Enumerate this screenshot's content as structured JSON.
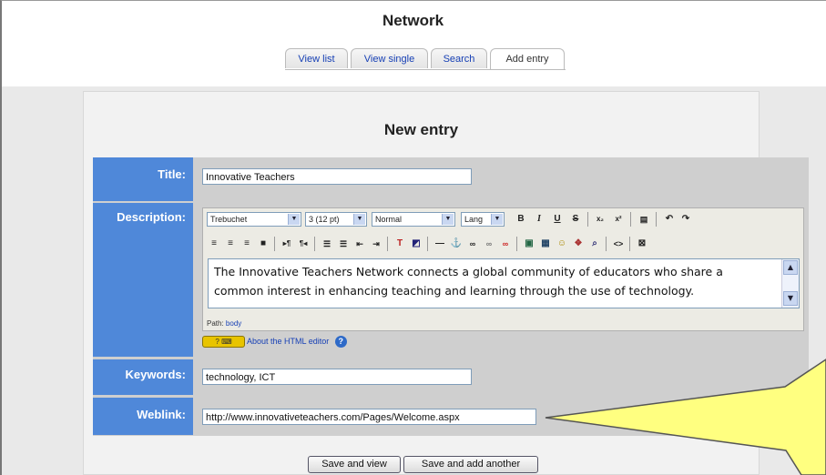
{
  "page": {
    "title": "Network"
  },
  "tabs": [
    {
      "label": "View list"
    },
    {
      "label": "View single"
    },
    {
      "label": "Search"
    },
    {
      "label": "Add entry"
    }
  ],
  "form": {
    "heading": "New entry",
    "title_label": "Title:",
    "title_value": "Innovative Teachers",
    "description_label": "Description:",
    "keywords_label": "Keywords:",
    "keywords_value": "technology, ICT",
    "weblink_label": "Weblink:",
    "weblink_value": "http://www.innovativeteachers.com/Pages/Welcome.aspx"
  },
  "editor": {
    "font_select": "Trebuchet",
    "size_select": "3 (12 pt)",
    "format_select": "Normal",
    "lang_select": "Lang",
    "content": "The Innovative Teachers Network connects a global community of educators who share a common interest in enhancing teaching and learning through the use of technology.",
    "path_label": "Path:",
    "path_value": "body",
    "about_link": "About the HTML editor",
    "help_symbol": "?",
    "toolbar_icons": [
      "bold-icon",
      "italic-icon",
      "underline-icon",
      "strikethrough-icon",
      "subscript-icon",
      "superscript-icon",
      "clean-word-icon",
      "undo-icon",
      "redo-icon",
      "align-left-icon",
      "align-center-icon",
      "align-right-icon",
      "justify-icon",
      "ltr-icon",
      "rtl-icon",
      "ordered-list-icon",
      "unordered-list-icon",
      "outdent-icon",
      "indent-icon",
      "text-color-icon",
      "bg-color-icon",
      "horizontal-rule-icon",
      "anchor-icon",
      "link-icon",
      "unlink-icon",
      "nolink-icon",
      "image-icon",
      "table-icon",
      "smiley-icon",
      "special-char-icon",
      "search-replace-icon",
      "html-source-icon",
      "fullscreen-icon"
    ]
  },
  "buttons": {
    "save_view": "Save and view",
    "save_add": "Save and add another"
  },
  "colors": {
    "label_bg": "#4f88d9",
    "callout": "#ffff80",
    "link": "#1740b5"
  }
}
